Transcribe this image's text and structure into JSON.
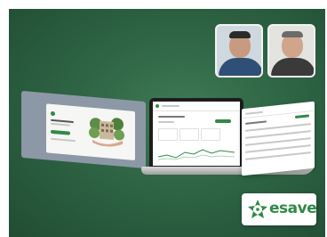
{
  "brand": {
    "name": "esave",
    "color": "#2f8a46"
  },
  "colors": {
    "background": "#2e6444",
    "accent": "#2f8a46"
  }
}
